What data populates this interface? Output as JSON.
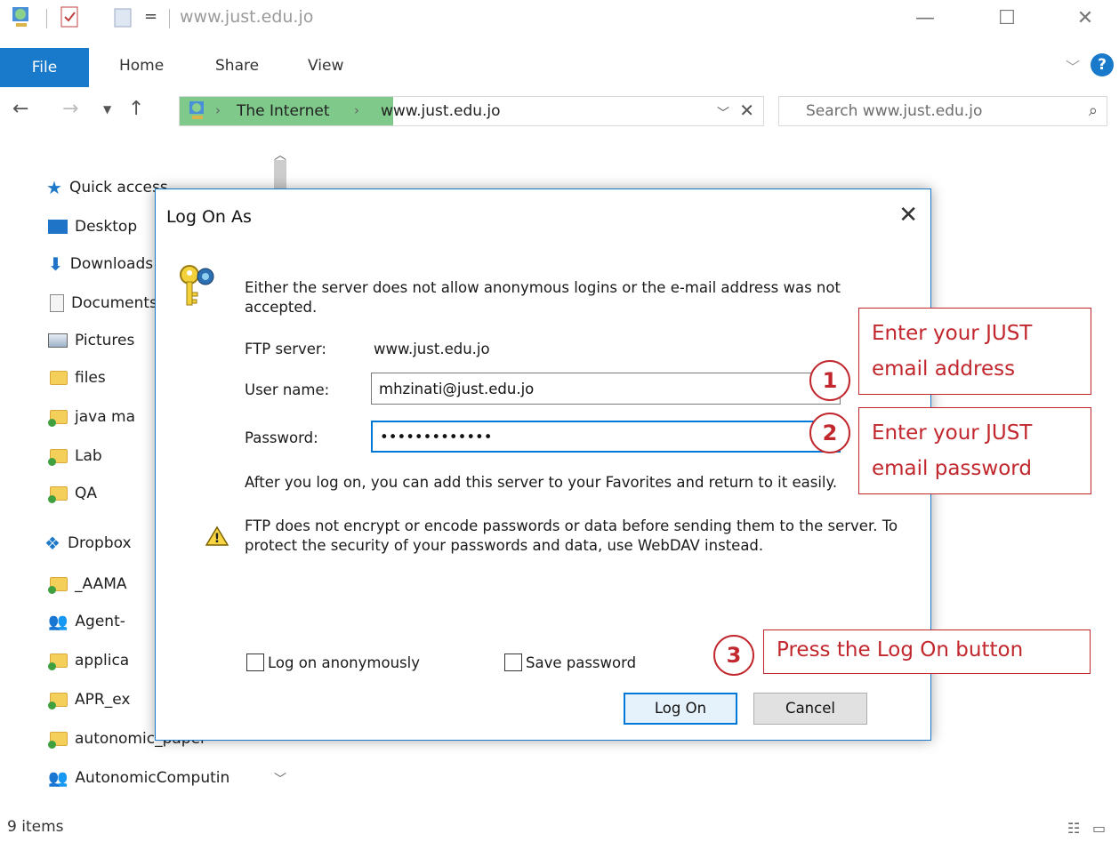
{
  "window": {
    "title": "www.just.edu.jo",
    "qa_toolbar_chevron": "="
  },
  "ribbon": {
    "tabs": [
      {
        "label": "File",
        "active": true
      },
      {
        "label": "Home"
      },
      {
        "label": "Share"
      },
      {
        "label": "View"
      }
    ],
    "help": "?"
  },
  "address": {
    "segments": [
      "The Internet",
      "www.just.edu.jo"
    ],
    "highlight_color": "#7fc98a",
    "search_placeholder": "Search www.just.edu.jo"
  },
  "sidebar": {
    "items": [
      {
        "label": "Quick access",
        "icon": "star-icon"
      },
      {
        "label": "Desktop",
        "icon": "desktop-icon"
      },
      {
        "label": "Downloads",
        "icon": "download-icon"
      },
      {
        "label": "Documents",
        "icon": "document-icon"
      },
      {
        "label": "Pictures",
        "icon": "pictures-icon"
      },
      {
        "label": "files",
        "icon": "folder-icon"
      },
      {
        "label": "java ma",
        "icon": "sync-folder-icon"
      },
      {
        "label": "Lab",
        "icon": "sync-folder-icon"
      },
      {
        "label": "QA",
        "icon": "sync-folder-icon"
      },
      {
        "label": "Dropbox",
        "icon": "dropbox-icon"
      },
      {
        "label": "_AAMA",
        "icon": "sync-folder-icon"
      },
      {
        "label": "Agent-",
        "icon": "users-folder-icon"
      },
      {
        "label": "applica",
        "icon": "sync-folder-icon"
      },
      {
        "label": "APR_ex",
        "icon": "sync-folder-icon"
      },
      {
        "label": "autonomic_paper",
        "icon": "sync-folder-icon"
      },
      {
        "label": "AutonomicComputin",
        "icon": "users-folder-icon"
      }
    ]
  },
  "status_bar": {
    "item_count": "9 items"
  },
  "dialog": {
    "title": "Log On As",
    "message": "Either the server does not allow anonymous logins or the e-mail address was not accepted.",
    "ftp_server_label": "FTP server:",
    "ftp_server_value": "www.just.edu.jo",
    "username_label": "User name:",
    "username_value": "mhzinati@just.edu.jo",
    "password_label": "Password:",
    "password_value": "•••••••••••••",
    "after_logon_message": "After you log on, you can add this server to your Favorites and return to it easily.",
    "warning_message": "FTP does not encrypt or encode passwords or data before sending them to the server.  To protect the security of your passwords and data, use WebDAV instead.",
    "anonymous_label": "Log on anonymously",
    "save_password_label": "Save password",
    "logon_button": "Log On",
    "cancel_button": "Cancel"
  },
  "annotations": [
    {
      "number": "1",
      "text_lines": [
        "Enter your JUST",
        "email address"
      ]
    },
    {
      "number": "2",
      "text_lines": [
        "Enter your JUST",
        "email password"
      ]
    },
    {
      "number": "3",
      "text_lines": [
        "Press the Log On button"
      ]
    }
  ],
  "colors": {
    "accent": "#1979ca",
    "annotation_red": "#c1272d",
    "folder_yellow": "#f4cf5a"
  }
}
